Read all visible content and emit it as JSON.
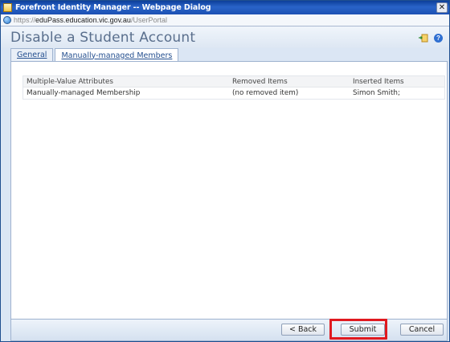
{
  "window": {
    "title": "Forefront Identity Manager -- Webpage Dialog",
    "close_glyph": "✕"
  },
  "address": {
    "prefix": "https://",
    "host": "eduPass.education.vic.gov.au",
    "path": "/UserPortal"
  },
  "header": {
    "title": "Disable a Student Account",
    "help_glyph": "?"
  },
  "tabs": [
    {
      "label": "General",
      "active": false
    },
    {
      "label": "Manually-managed Members",
      "active": true
    }
  ],
  "table": {
    "columns": [
      "Multiple-Value Attributes",
      "Removed Items",
      "Inserted Items"
    ],
    "rows": [
      [
        "Manually-managed Membership",
        "(no removed item)",
        "Simon Smith;"
      ]
    ]
  },
  "footer": {
    "back_label": "< Back",
    "submit_label": "Submit",
    "cancel_label": "Cancel"
  },
  "colors": {
    "highlight": "#e0191f",
    "title_text": "#5a6f8d",
    "titlebar": "#1b50b3"
  },
  "icons": [
    "app-icon",
    "close-icon",
    "globe-icon",
    "export-icon",
    "help-icon"
  ]
}
